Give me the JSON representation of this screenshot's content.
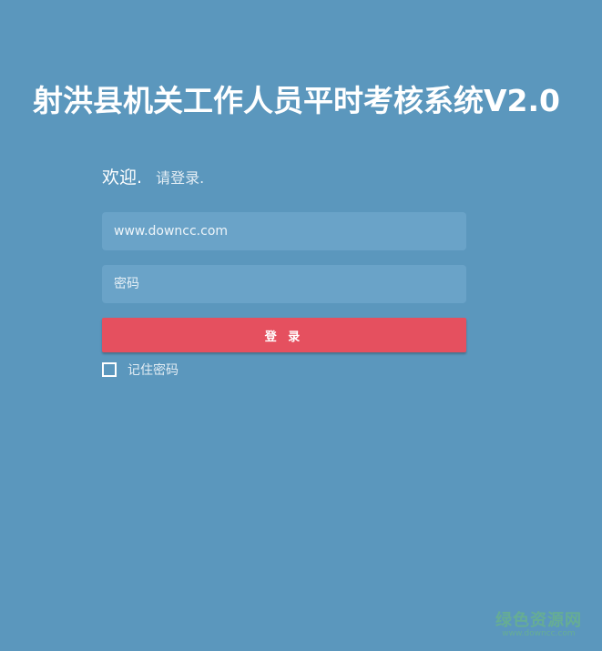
{
  "app": {
    "title": "射洪县机关工作人员平时考核系统V2.0"
  },
  "login": {
    "welcome": "欢迎.",
    "prompt": "请登录.",
    "username_value": "www.downcc.com",
    "password_placeholder": "密码",
    "submit_label": "登 录",
    "remember_label": "记住密码",
    "remember_checked": false
  },
  "watermark": {
    "main": "绿色资源网",
    "sub": "www.downcc.com"
  },
  "colors": {
    "background": "#5b97bd",
    "field": "#6aa3c8",
    "button": "#e5505f"
  }
}
